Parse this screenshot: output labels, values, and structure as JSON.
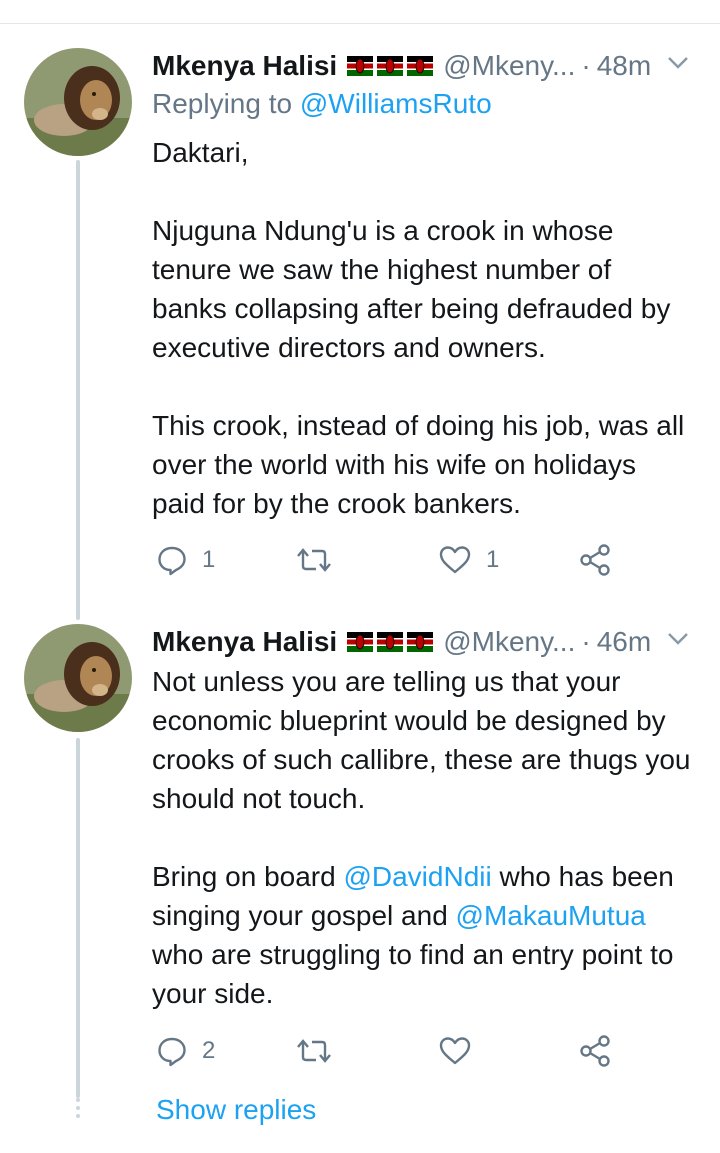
{
  "tweets": [
    {
      "author_name": "Mkenya Halisi",
      "handle": "@Mkeny...",
      "separator": "·",
      "time": "48m",
      "replying_prefix": "Replying to",
      "replying_handle": "@WilliamsRuto",
      "paragraphs": [
        "Daktari,",
        "Njuguna Ndung'u is a crook in whose tenure we saw the highest number of banks collapsing after being defrauded by executive directors and owners.",
        "This crook, instead of doing his job, was all over the world with his wife on holidays paid for by the crook bankers."
      ],
      "reply_count": "1",
      "retweet_count": "",
      "like_count": "1"
    },
    {
      "author_name": "Mkenya Halisi",
      "handle": "@Mkeny...",
      "separator": "·",
      "time": "46m",
      "p1": "Not unless you are telling us that your economic blueprint would be designed by crooks of such callibre, these are thugs you should not touch.",
      "p2_a": "Bring on board ",
      "p2_mention1": "@DavidNdii",
      "p2_b": " who has been singing your gospel and ",
      "p2_mention2": "@MakauMutua",
      "p2_c": " who are struggling to find an entry point to your side.",
      "reply_count": "2",
      "retweet_count": "",
      "like_count": ""
    }
  ],
  "show_replies_label": "Show replies",
  "icons": {
    "reply": "reply-icon",
    "retweet": "retweet-icon",
    "like": "heart-icon",
    "share": "share-icon",
    "caret": "chevron-down-icon",
    "flag": "kenya-flag-icon"
  },
  "colors": {
    "link": "#1da1f2",
    "secondary_text": "#657786",
    "primary_text": "#14171a",
    "thread_line": "#cbd5dc"
  }
}
